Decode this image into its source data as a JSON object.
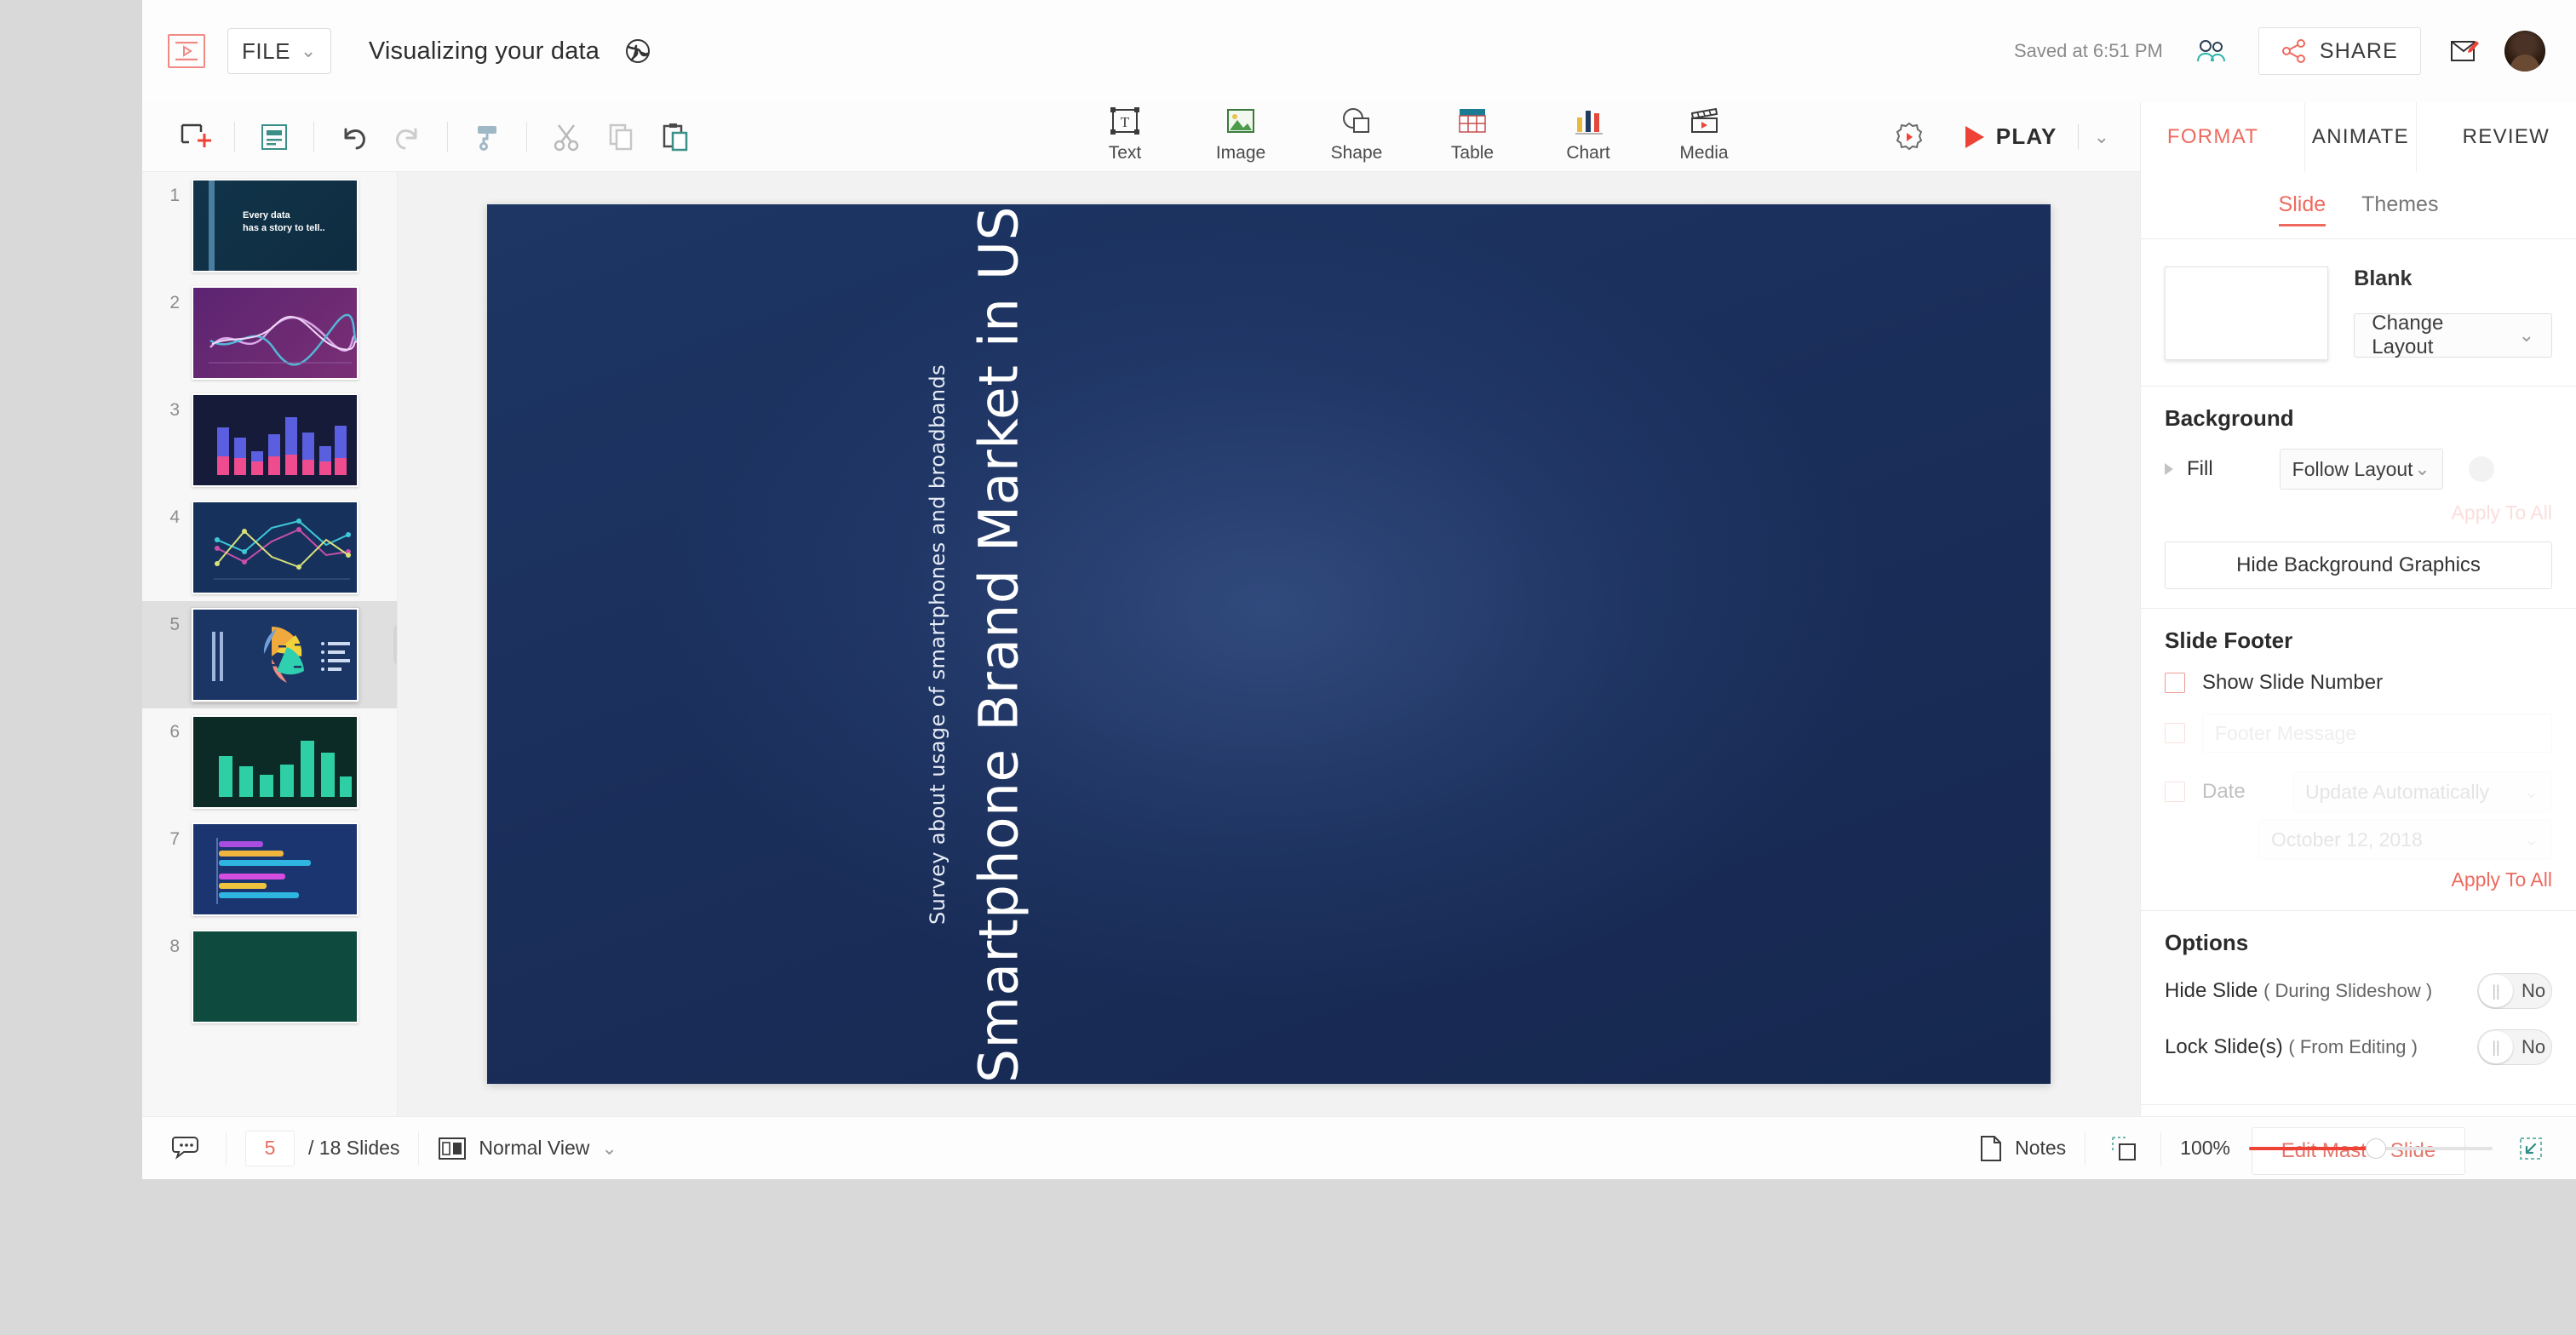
{
  "header": {
    "logo_icon": "presentation-logo-icon",
    "file_menu": "FILE",
    "doc_title": "Visualizing  your data",
    "globe_icon": "globe-icon",
    "saved_status": "Saved at 6:51 PM",
    "collaborators_icon": "collaborators-icon",
    "share_label": "SHARE",
    "share_icon": "share-nodes-icon",
    "feedback_icon": "compose-pen-icon",
    "avatar_label": "user-avatar"
  },
  "toolbar": {
    "tools": [
      {
        "name": "add-slide-icon"
      },
      {
        "name": "slide-layout-icon"
      },
      {
        "name": "undo-icon"
      },
      {
        "name": "redo-icon"
      },
      {
        "name": "paint-format-icon"
      },
      {
        "name": "cut-icon"
      },
      {
        "name": "copy-icon"
      },
      {
        "name": "paste-icon"
      }
    ],
    "insert_items": [
      {
        "label": "Text",
        "icon": "text-box-icon"
      },
      {
        "label": "Image",
        "icon": "image-icon"
      },
      {
        "label": "Shape",
        "icon": "shape-icon"
      },
      {
        "label": "Table",
        "icon": "table-icon"
      },
      {
        "label": "Chart",
        "icon": "chart-icon"
      },
      {
        "label": "Media",
        "icon": "media-clapper-icon"
      }
    ],
    "settings_icon": "settings-gear-icon",
    "play_label": "PLAY",
    "play_caret": "⌄"
  },
  "panel": {
    "tabs": [
      {
        "label": "FORMAT",
        "active": true
      },
      {
        "label": "ANIMATE",
        "active": false
      },
      {
        "label": "REVIEW",
        "active": false
      }
    ],
    "sub_tabs": [
      {
        "label": "Slide",
        "active": true
      },
      {
        "label": "Themes",
        "active": false
      }
    ],
    "layout": {
      "name": "Blank",
      "change_layout_label": "Change Layout",
      "caret": "⌄"
    },
    "background": {
      "heading": "Background",
      "fill_label": "Fill",
      "fill_value": "Follow Layout",
      "apply_to_all": "Apply To All",
      "hide_graphics_label": "Hide Background Graphics"
    },
    "slide_footer": {
      "heading": "Slide Footer",
      "show_slide_number": "Show Slide Number",
      "footer_message_placeholder": "Footer Message",
      "date_label": "Date",
      "date_mode": "Update Automatically",
      "date_value": "October 12, 2018",
      "apply_to_all": "Apply To All"
    },
    "options": {
      "heading": "Options",
      "hide_slide_label": "Hide Slide",
      "hide_slide_note": "( During Slideshow )",
      "hide_slide_value": "No",
      "lock_slide_label": "Lock Slide(s)",
      "lock_slide_note": "( From Editing )",
      "lock_slide_value": "No"
    },
    "edit_master_label": "Edit Master Slide"
  },
  "slides": [
    {
      "num": "1",
      "kind": "title",
      "line1": "Every data",
      "line2": "has a story to tell.."
    },
    {
      "num": "2",
      "kind": "line-purple"
    },
    {
      "num": "3",
      "kind": "bar-pink"
    },
    {
      "num": "4",
      "kind": "line-multi"
    },
    {
      "num": "5",
      "kind": "pie",
      "selected": true
    },
    {
      "num": "6",
      "kind": "bar-teal"
    },
    {
      "num": "7",
      "kind": "hbar"
    },
    {
      "num": "8",
      "kind": "green"
    }
  ],
  "canvas": {
    "title": "Smartphone Brand Market in US",
    "subtitle": "Survey about usage of smartphones and broadbands"
  },
  "status": {
    "comments_icon": "comments-icon",
    "current_slide": "5",
    "total_slides": "/ 18 Slides",
    "view_icon": "view-layout-icon",
    "view_mode": "Normal View",
    "view_caret": "⌄",
    "notes_icon": "notes-page-icon",
    "notes_label": "Notes",
    "fit_icon": "fit-selection-icon",
    "zoom_level": "100%",
    "fit_screen_icon": "fit-to-screen-icon"
  },
  "colors": {
    "accent": "#ee6a5f",
    "play_red": "#ee4236",
    "slide_bg": "#1b2f5c"
  }
}
